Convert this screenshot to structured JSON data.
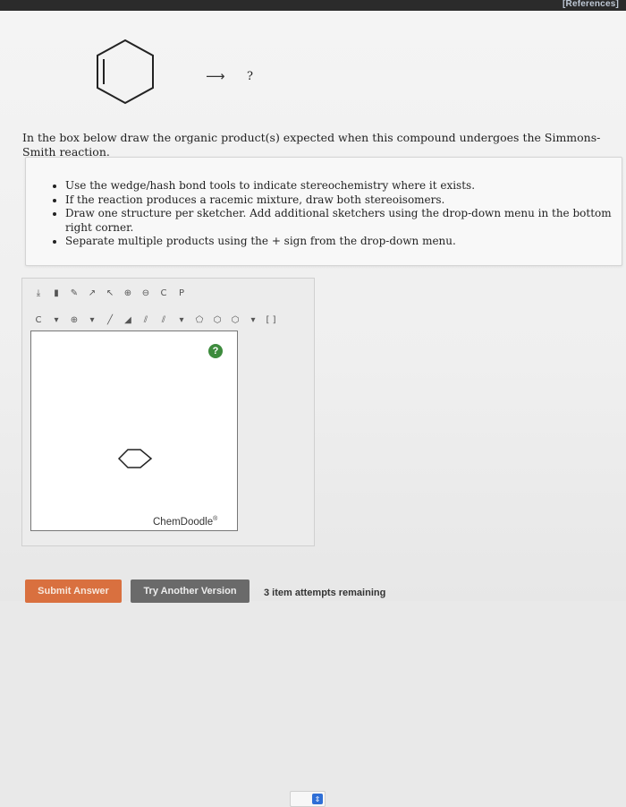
{
  "header": {
    "references_label": "[References]"
  },
  "reaction": {
    "arrow": "⟶",
    "product": "?"
  },
  "question": {
    "text": "In the box below draw the organic product(s) expected when this compound undergoes the Simmons-Smith reaction."
  },
  "instructions": {
    "items": [
      "Use the wedge/hash bond tools to indicate stereochemistry where it exists.",
      "If the reaction produces a racemic mixture, draw both stereoisomers.",
      "Draw one structure per sketcher. Add additional sketchers using the drop-down menu in the bottom right corner.",
      "Separate multiple products using the + sign from the drop-down menu."
    ]
  },
  "sketcher": {
    "toolbar_row1": [
      {
        "name": "clear-icon",
        "glyph": "⤓"
      },
      {
        "name": "erase-icon",
        "glyph": "▮"
      },
      {
        "name": "pencil-icon",
        "glyph": "✎"
      },
      {
        "name": "lasso-icon",
        "glyph": "↗"
      },
      {
        "name": "select-icon",
        "glyph": "↖"
      },
      {
        "name": "zoom-in-icon",
        "glyph": "⊕"
      },
      {
        "name": "zoom-out-icon",
        "glyph": "⊖"
      },
      {
        "name": "copy-icon",
        "glyph": "C"
      },
      {
        "name": "paste-icon",
        "glyph": "P"
      }
    ],
    "toolbar_row2": [
      {
        "name": "carbon-atom-icon",
        "glyph": "C"
      },
      {
        "name": "atom-dropdown-icon",
        "glyph": "▾"
      },
      {
        "name": "charge-icon",
        "glyph": "⊕"
      },
      {
        "name": "charge-dropdown-icon",
        "glyph": "▾"
      },
      {
        "name": "single-bond-icon",
        "glyph": "╱"
      },
      {
        "name": "wedge-bond-icon",
        "glyph": "◢"
      },
      {
        "name": "hash-bond-icon",
        "glyph": "⫽"
      },
      {
        "name": "double-bond-icon",
        "glyph": "⫽"
      },
      {
        "name": "bond-dropdown-icon",
        "glyph": "▾"
      },
      {
        "name": "ring-cyclopentane-icon",
        "glyph": "⬠"
      },
      {
        "name": "ring-cyclohexane-icon",
        "glyph": "⬡"
      },
      {
        "name": "ring-benzene-icon",
        "glyph": "⬡"
      },
      {
        "name": "ring-dropdown-icon",
        "glyph": "▾"
      },
      {
        "name": "bracket-icon",
        "glyph": "[ ]"
      }
    ],
    "help_label": "?",
    "brand": "ChemDoodle",
    "brand_mark": "®"
  },
  "buttons": {
    "submit_label": "Submit Answer",
    "try_label": "Try Another Version"
  },
  "attempts_text": "3 item attempts remaining",
  "colors": {
    "submit": "#d9703f",
    "try": "#6a6a6a",
    "help": "#3d8b3d",
    "dropdown": "#2f6fd6"
  }
}
